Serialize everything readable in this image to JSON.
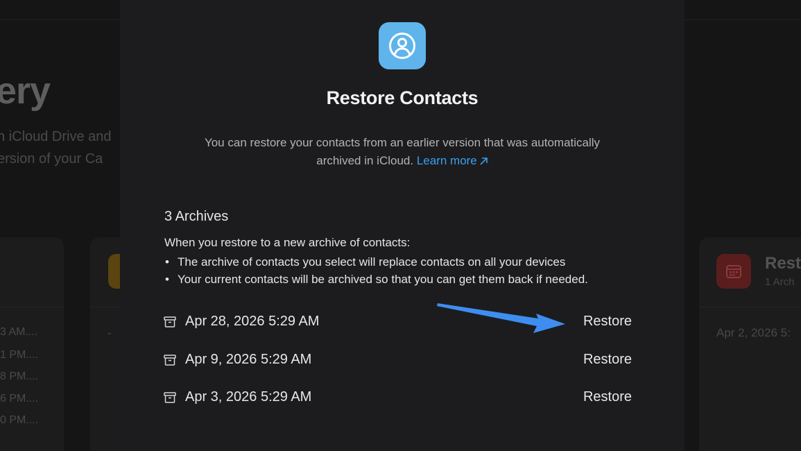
{
  "background": {
    "title": "ery",
    "desc_line1": "h iCloud Drive and",
    "desc_line2": "ersion of your Ca",
    "times": [
      "3 AM....",
      "1 PM....",
      "8 PM....",
      "6 PM....",
      "0 PM...."
    ],
    "dash": "-",
    "right_card": {
      "title": "Rest",
      "subtitle": "1 Arch",
      "date": "Apr 2, 2026 5:"
    }
  },
  "modal": {
    "icon": "person-circle-icon",
    "title": "Restore Contacts",
    "description_line1": "You can restore your contacts from an earlier version that was automatically",
    "description_line2": "archived in iCloud.",
    "learn_more": "Learn more",
    "archives_count": "3 Archives",
    "info_intro": "When you restore to a new archive of contacts:",
    "bullets": [
      "The archive of contacts you select will replace contacts on all your devices",
      "Your current contacts will be archived so that you can get them back if needed."
    ],
    "archives": [
      {
        "date": "Apr 28, 2026 5:29 AM",
        "action": "Restore"
      },
      {
        "date": "Apr 9, 2026 5:29 AM",
        "action": "Restore"
      },
      {
        "date": "Apr 3, 2026 5:29 AM",
        "action": "Restore"
      }
    ]
  },
  "colors": {
    "icon_bg": "#5fb4ec",
    "link": "#3b9ef0",
    "arrow": "#3d8ef0"
  }
}
